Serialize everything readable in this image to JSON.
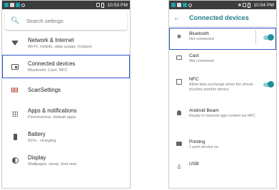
{
  "left": {
    "status": {
      "time": "10:53 PM"
    },
    "search": {
      "placeholder": "Search settings"
    },
    "items": [
      {
        "title": "Network & Internet",
        "subtitle": "Wi-Fi, mobile, data usage, hotspot",
        "icon": "wifi-icon"
      },
      {
        "title": "Connected devices",
        "subtitle": "Bluetooth, Cast, NFC",
        "icon": "connected-devices-icon"
      },
      {
        "title": "ScanSettings",
        "subtitle": "",
        "icon": "barcode-scan-icon"
      },
      {
        "title": "Apps & notifications",
        "subtitle": "Permissions, default apps",
        "icon": "apps-grid-icon"
      },
      {
        "title": "Battery",
        "subtitle": "91% - charging",
        "icon": "battery-icon"
      },
      {
        "title": "Display",
        "subtitle": "Wallpaper, sleep, font size",
        "icon": "display-brightness-icon"
      }
    ]
  },
  "right": {
    "status": {
      "time": "10:54 PM"
    },
    "title": "Connected devices",
    "items": [
      {
        "title": "Bluetooth",
        "subtitle": "Not connected",
        "toggle": true,
        "icon": "bluetooth-icon"
      },
      {
        "title": "Cast",
        "subtitle": "Not connected",
        "icon": "cast-icon"
      },
      {
        "title": "NFC",
        "subtitle": "Allow data exchange when the phone touches another device",
        "toggle": true,
        "icon": "nfc-icon"
      },
      {
        "title": "Android Beam",
        "subtitle": "Ready to transmit app content via NFC",
        "icon": "android-icon"
      },
      {
        "title": "Printing",
        "subtitle": "1 print service on",
        "icon": "printer-icon"
      },
      {
        "title": "USB",
        "subtitle": "",
        "icon": "usb-icon"
      }
    ]
  },
  "colors": {
    "accent": "#1f7f8c",
    "highlight": "#2d54c2",
    "statusbar": "#3c3c3c"
  }
}
